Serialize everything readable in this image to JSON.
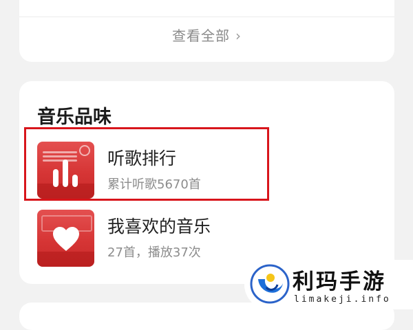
{
  "top_card": {
    "view_all_label": "查看全部",
    "chevron": "›"
  },
  "music_taste": {
    "title": "音乐品味",
    "items": [
      {
        "title": "听歌排行",
        "subtitle": "累计听歌5670首",
        "icon": "bar-chart-icon",
        "highlighted": true
      },
      {
        "title": "我喜欢的音乐",
        "subtitle": "27首，播放37次",
        "icon": "heart-icon",
        "highlighted": false
      }
    ]
  },
  "colors": {
    "highlight": "#d8151b",
    "thumb_red": "#d63535",
    "accent_blue": "#1e6fd9"
  },
  "watermark": {
    "title": "利玛手游",
    "url": "limakeji.info"
  }
}
